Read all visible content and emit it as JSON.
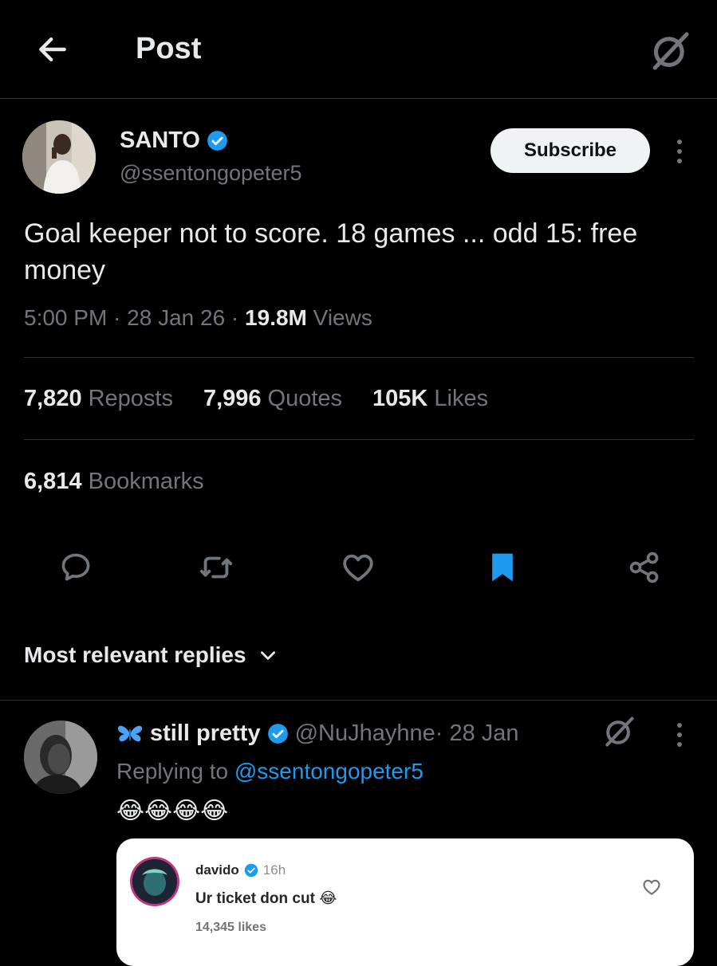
{
  "header": {
    "title": "Post",
    "back_icon": "arrow-left-icon",
    "grok_icon": "grok-icon"
  },
  "author": {
    "name": "SANTO",
    "handle": "@ssentongopeter5",
    "verified": true
  },
  "subscribe_label": "Subscribe",
  "post": {
    "text": "Goal keeper not to score. 18 games ... odd 15: free money",
    "time": "5:00 PM · 28 Jan 26 · ",
    "views_count": "19.8M",
    "views_label": " Views"
  },
  "stats": {
    "reposts_count": "7,820",
    "reposts_label": "Reposts",
    "quotes_count": "7,996",
    "quotes_label": "Quotes",
    "likes_count": "105K",
    "likes_label": "Likes",
    "bookmarks_count": "6,814",
    "bookmarks_label": "Bookmarks"
  },
  "actions": [
    "reply-icon",
    "repost-icon",
    "like-icon",
    "bookmark-icon",
    "share-icon"
  ],
  "replies_filter": {
    "label": "Most relevant replies"
  },
  "reply": {
    "name": "still pretty",
    "handle": "@NuJhayhne",
    "date": " · 28 Jan",
    "replying_prefix": "Replying to ",
    "replying_handle": "@ssentongopeter5",
    "emojis": "😂😂😂😂"
  },
  "embedded_comment": {
    "user": "davido",
    "time": "16h",
    "text": "Ur ticket don cut",
    "emoji": "😂",
    "likes": "14,345 likes"
  },
  "colors": {
    "accent": "#1d9bf0",
    "bookmark_active": "#1d9bf0",
    "muted": "#71767b",
    "background": "#000000"
  }
}
